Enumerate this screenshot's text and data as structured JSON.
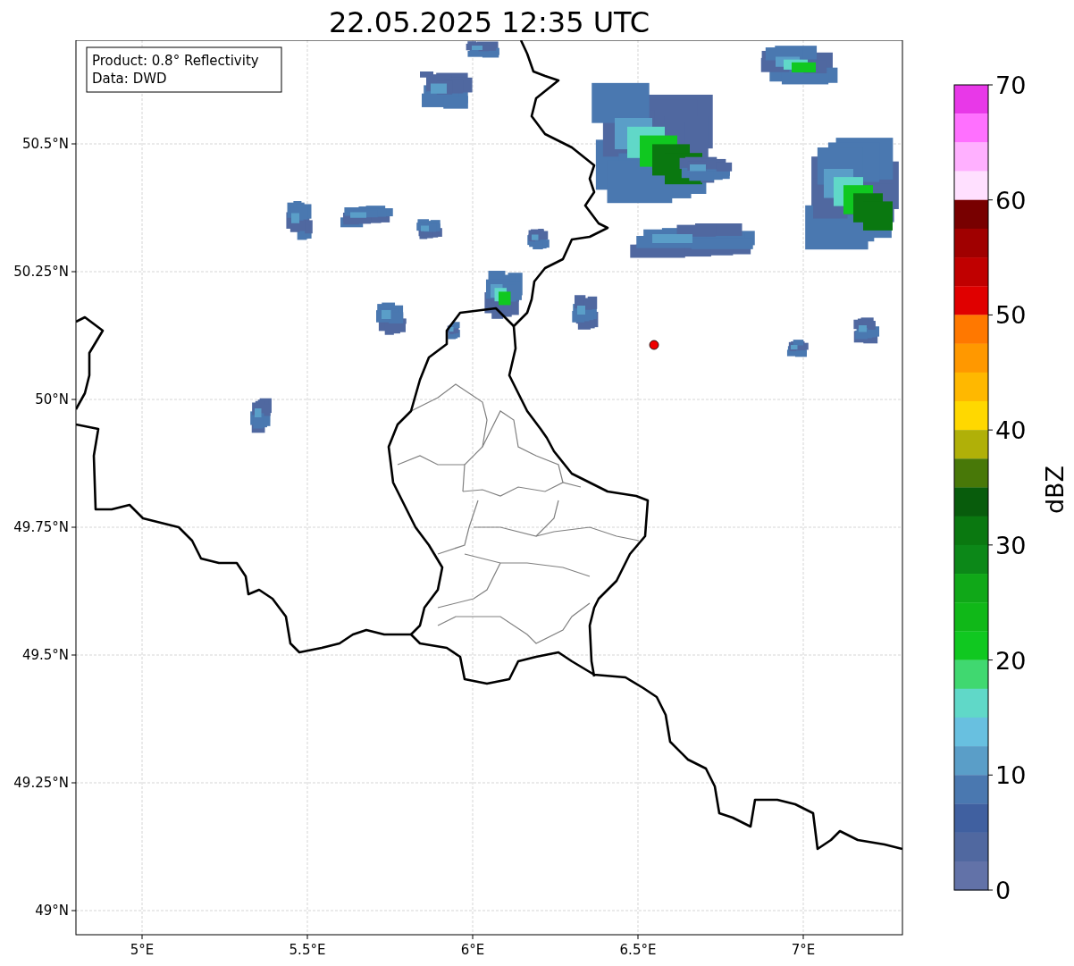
{
  "title": "22.05.2025 12:35 UTC",
  "info_box": {
    "lines": [
      "Product: 0.8° Reflectivity",
      "Data: DWD"
    ]
  },
  "map": {
    "lat_ticks": [
      "50.5°N",
      "50.25°N",
      "50°N",
      "49.75°N",
      "49.5°N",
      "49.25°N",
      "49°N"
    ],
    "lon_ticks": [
      "5°E",
      "5.5°E",
      "6°E",
      "6.5°E",
      "7°E"
    ]
  },
  "colorbar": {
    "label": "dBZ",
    "ticks": [
      "70",
      "60",
      "50",
      "40",
      "30",
      "20",
      "10",
      "0"
    ],
    "segments": [
      {
        "color": "#e838e8"
      },
      {
        "color": "#ff70ff"
      },
      {
        "color": "#ffb0ff"
      },
      {
        "color": "#ffe0ff"
      },
      {
        "color": "#780000"
      },
      {
        "color": "#a00000"
      },
      {
        "color": "#c00000"
      },
      {
        "color": "#e00000"
      },
      {
        "color": "#ff7800"
      },
      {
        "color": "#ff9800"
      },
      {
        "color": "#ffb800"
      },
      {
        "color": "#ffd800"
      },
      {
        "color": "#b0b008"
      },
      {
        "color": "#487808"
      },
      {
        "color": "#085c0c"
      },
      {
        "color": "#0a7810"
      },
      {
        "color": "#0c8818"
      },
      {
        "color": "#10a818"
      },
      {
        "color": "#10b818"
      },
      {
        "color": "#10c820"
      },
      {
        "color": "#40d870"
      },
      {
        "color": "#60d8c8"
      },
      {
        "color": "#68c0e0"
      },
      {
        "color": "#5a9ec8"
      },
      {
        "color": "#4a78b0"
      },
      {
        "color": "#4060a0"
      },
      {
        "color": "#5068a0"
      },
      {
        "color": "#6272a8"
      }
    ]
  }
}
